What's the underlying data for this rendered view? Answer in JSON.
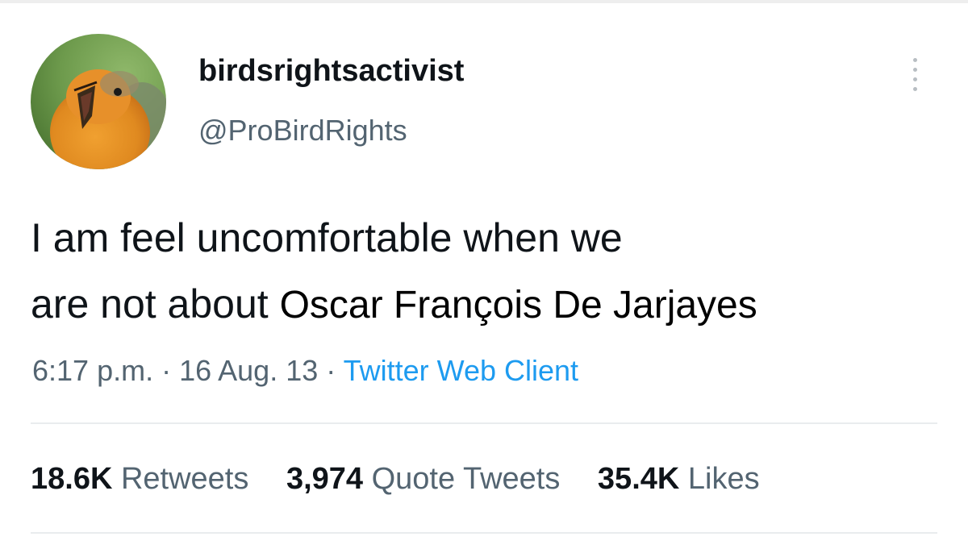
{
  "tweet": {
    "display_name": "birdsrightsactivist",
    "handle": "@ProBirdRights",
    "text_line1": "I am feel uncomfortable when we",
    "text_line2": "are not about ",
    "text_overlay": "Oscar François De Jarjayes",
    "time": "6:17 p.m.",
    "separator": " · ",
    "date": "16 Aug. 13",
    "source": "Twitter Web Client"
  },
  "stats": {
    "retweets_count": "18.6K",
    "retweets_label": " Retweets",
    "quotes_count": "3,974",
    "quotes_label": " Quote Tweets",
    "likes_count": "35.4K",
    "likes_label": " Likes"
  },
  "icons": {
    "avatar": "robin-bird-avatar",
    "more": "more-vertical-icon"
  },
  "colors": {
    "text": "#0f1419",
    "secondary": "#536471",
    "link": "#1d9bf0",
    "divider": "#e9ecee"
  }
}
